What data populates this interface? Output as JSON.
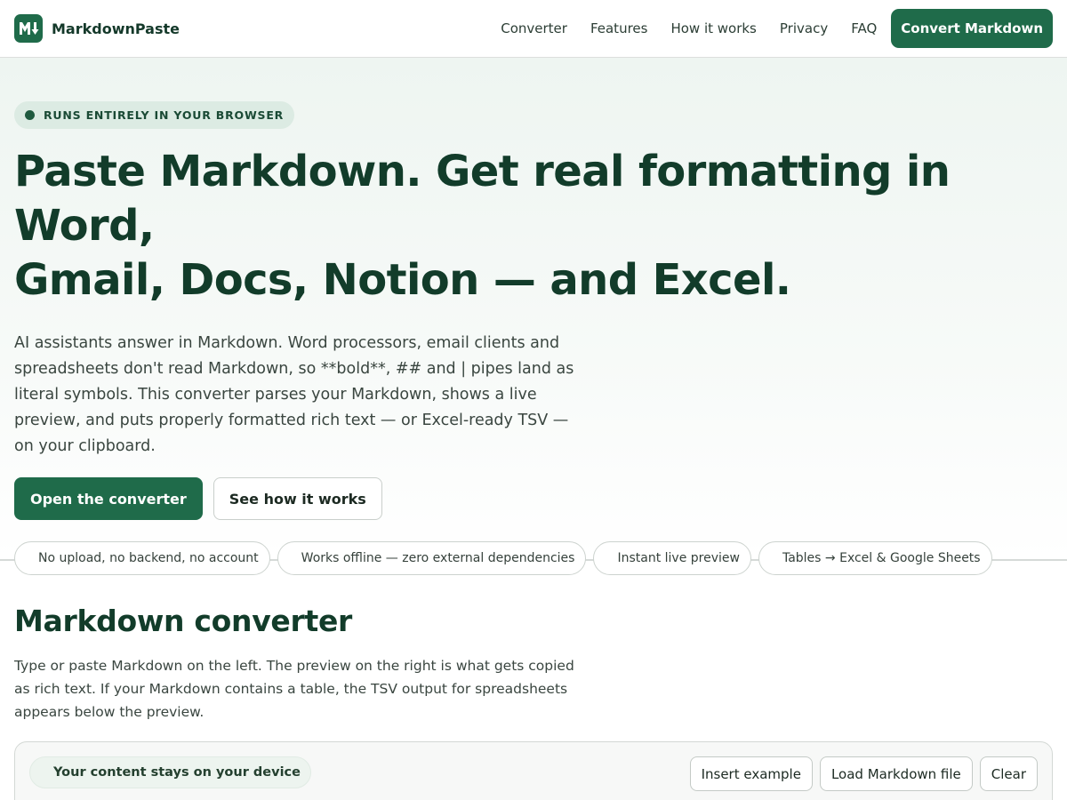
{
  "header": {
    "brand": "MarkdownPaste",
    "logo_icon": "markdown-logo-icon",
    "nav": [
      "Converter",
      "Features",
      "How it works",
      "Privacy",
      "FAQ"
    ],
    "cta": "Convert Markdown"
  },
  "hero": {
    "badge": "RUNS ENTIRELY IN YOUR BROWSER",
    "title_line1": "Paste Markdown. Get real formatting in Word,",
    "title_line2": "Gmail, Docs, Notion — and Excel.",
    "lede": "AI assistants answer in Markdown. Word processors, email clients and spreadsheets don't read Markdown, so **bold**, ## and | pipes land as literal symbols. This converter parses your Markdown, shows a live preview, and puts properly formatted rich text — or Excel-ready TSV — on your clipboard.",
    "primary_button": "Open the converter",
    "secondary_button": "See how it works",
    "features": [
      "No upload, no backend, no account",
      "Works offline — zero external dependencies",
      "Instant live preview",
      "Tables → Excel & Google Sheets"
    ]
  },
  "converter": {
    "title": "Markdown converter",
    "description": "Type or paste Markdown on the left. The preview on the right is what gets copied as rich text. If your Markdown contains a table, the TSV output for spreadsheets appears below the preview.",
    "privacy_badge": "Your content stays on your device",
    "actions": [
      "Insert example",
      "Load Markdown file",
      "Clear"
    ]
  },
  "colors": {
    "accent": "#1f6b4a",
    "heading": "#123c2a",
    "hero_bg": "#eef5f1"
  }
}
